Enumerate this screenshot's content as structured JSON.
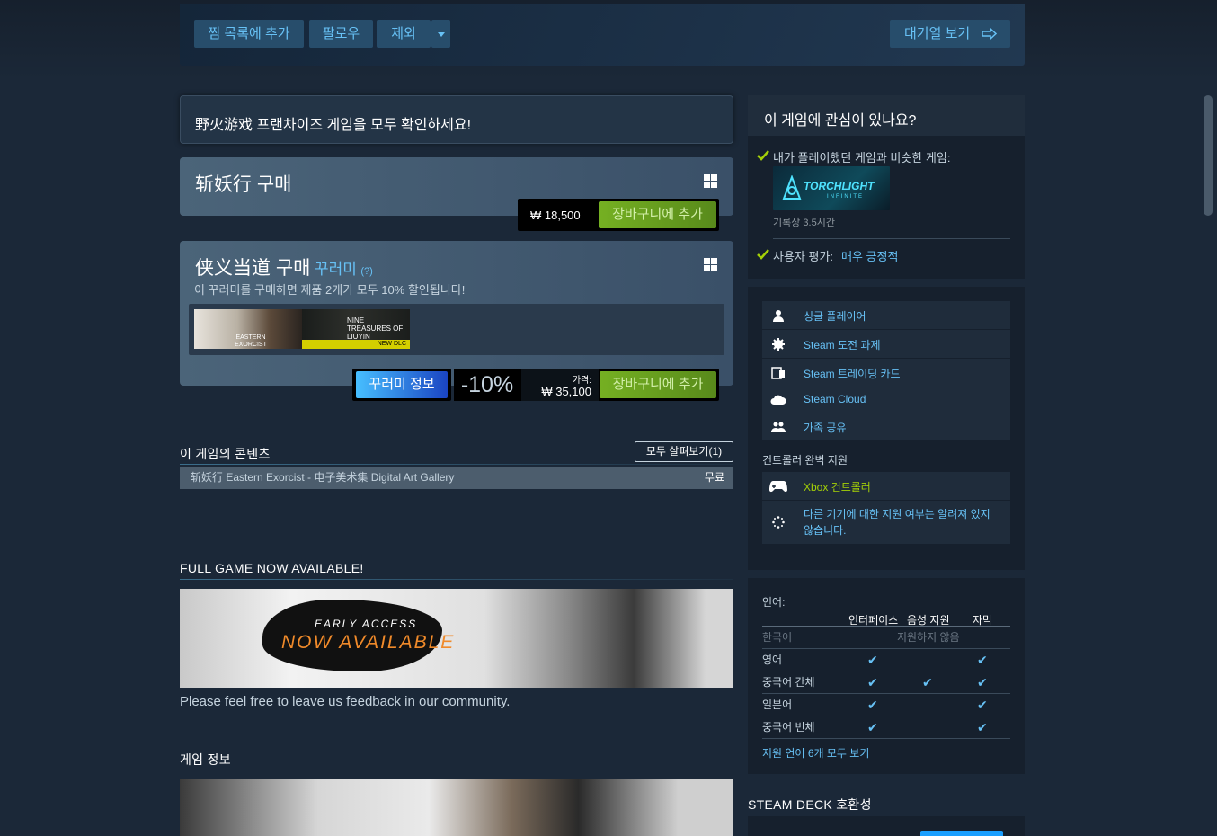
{
  "topbar": {
    "wishlist": "찜 목록에 추가",
    "follow": "팔로우",
    "ignore": "제외",
    "queue": "대기열 보기"
  },
  "franchise": {
    "text": "野火游戏 프랜차이즈 게임을 모두 확인하세요!"
  },
  "purchase1": {
    "title": "斩妖行 구매",
    "price": "₩ 18,500",
    "cart": "장바구니에 추가"
  },
  "purchase2": {
    "title": "侠义当道 구매",
    "bundle": "꾸러미",
    "help": "(?)",
    "desc": "이 꾸러미를 구매하면 제품 2개가 모두 10% 할인됩니다!",
    "thumb1_text": "EASTERN EXORCIST",
    "thumb2_text": "NINE TREASURES OF LIUYIN",
    "thumb2_tag": "NEW DLC",
    "info": "꾸러미 정보",
    "discount": "-10%",
    "price_label": "가격:",
    "price": "₩ 35,100",
    "cart": "장바구니에 추가"
  },
  "content": {
    "heading": "이 게임의 콘텐츠",
    "browse": "모두 살펴보기(1)",
    "dlc_name": "斩妖行 Eastern Exorcist - 电子美术集 Digital Art Gallery",
    "dlc_price": "무료"
  },
  "full_game": {
    "heading": "FULL GAME NOW AVAILABLE!",
    "banner_line1": "EARLY ACCESS",
    "banner_line2": "NOW AVAILABLE",
    "feedback": "Please feel free to leave us feedback in our community."
  },
  "game_info": {
    "heading": "게임 정보"
  },
  "interest": {
    "heading": "이 게임에 관심이 있나요?",
    "similar": "내가 플레이했던 게임과 비슷한 게임:",
    "similar_game": "TORCHLIGHT",
    "similar_game_sub": "INFINITE",
    "playtime": "기록상 3.5시간",
    "review_label": "사용자 평가:",
    "review_value": "매우 긍정적"
  },
  "features": {
    "items": [
      "싱글 플레이어",
      "Steam 도전 과제",
      "Steam 트레이딩 카드",
      "Steam Cloud",
      "가족 공유"
    ],
    "controller_label": "컨트롤러 완벽 지원",
    "xbox": "Xbox 컨트롤러",
    "other_devices": "다른 기기에 대한 지원 여부는 알려져 있지 않습니다."
  },
  "languages": {
    "label": "언어:",
    "cols": [
      "인터페이스",
      "음성 지원",
      "자막"
    ],
    "rows": [
      {
        "name": "한국어",
        "note": "지원하지 않음"
      },
      {
        "name": "영어"
      },
      {
        "name": "중국어 간체"
      },
      {
        "name": "일본어"
      },
      {
        "name": "중국어 번체"
      }
    ],
    "check": "✔",
    "all": "지원 언어 6개 모두 보기"
  },
  "steam_deck": {
    "heading": "STEAM DECK 호환성"
  },
  "colors": {
    "accent_blue": "#67c1f5",
    "cart_green": "#75b022",
    "bg": "#1b2838"
  }
}
